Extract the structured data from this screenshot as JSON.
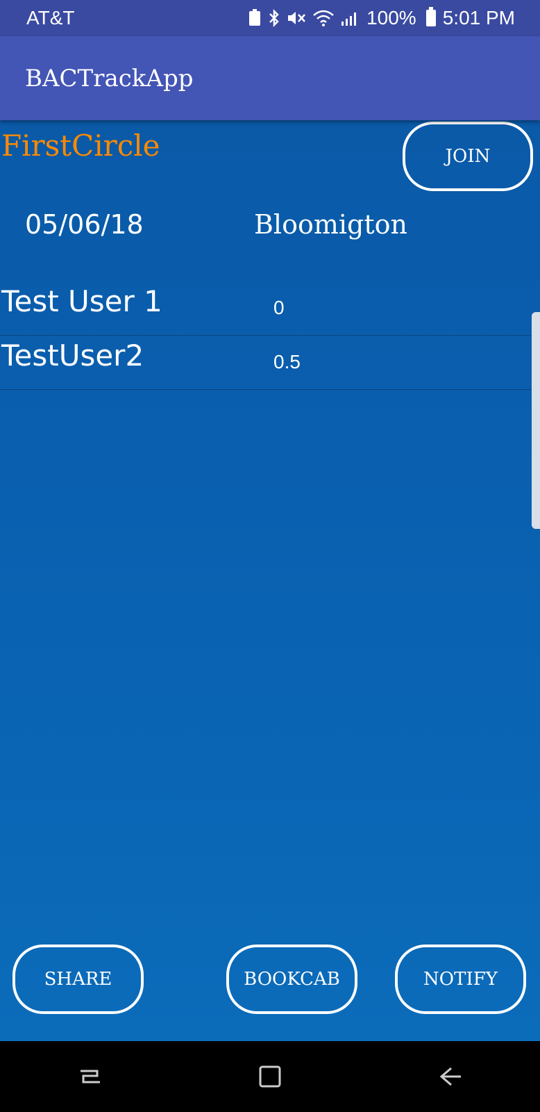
{
  "status_bar": {
    "carrier": "AT&T",
    "battery": "100%",
    "time": "5:01 PM"
  },
  "app_bar": {
    "title": "BACTrackApp"
  },
  "circle": {
    "name": "FirstCircle",
    "join_label": "JOIN",
    "date": "05/06/18",
    "location": "Bloomigton"
  },
  "users": [
    {
      "name": "Test User 1",
      "bac": "0"
    },
    {
      "name": "TestUser2",
      "bac": "0.5"
    }
  ],
  "actions": {
    "share_label": "SHARE",
    "bookcab_label": "BOOKCAB",
    "notify_label": "NOTIFY"
  },
  "colors": {
    "status_bar": "#3a4aa0",
    "app_bar": "#4355b5",
    "content_bg": "#0a5aa8",
    "accent_title": "#ff8a00"
  }
}
